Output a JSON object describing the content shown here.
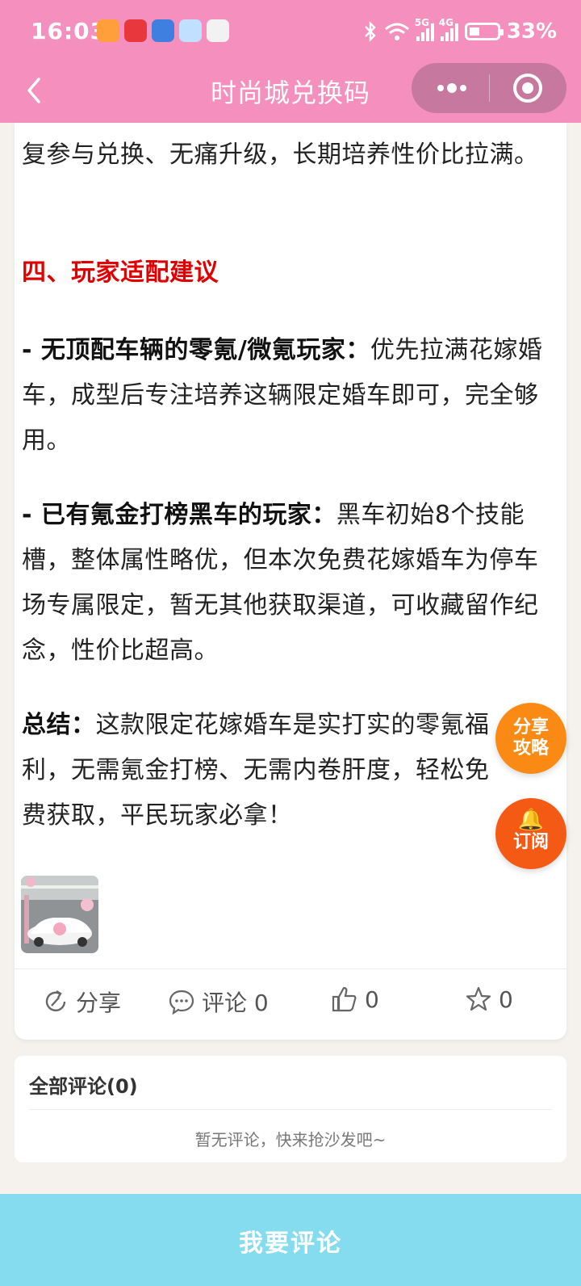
{
  "status_bar": {
    "time": "16:03",
    "network_1": "5G",
    "network_2": "4G",
    "battery": "33%"
  },
  "header": {
    "title": "时尚城兑换码"
  },
  "article": {
    "para1": "复参与兑换、无痛升级，长期培养性价比拉满。",
    "heading4": "四、玩家适配建议",
    "tip1_bold": "- 无顶配车辆的零氪/微氪玩家：",
    "tip1_text": "优先拉满花嫁婚车，成型后专注培养这辆限定婚车即可，完全够用。",
    "tip2_bold": "- 已有氪金打榜黑车的玩家：",
    "tip2_text": "黑车初始8个技能槽，整体属性略优，但本次免费花嫁婚车为停车场专属限定，暂无其他获取渠道，可收藏留作纪念，性价比超高。",
    "summary_bold": "总结：",
    "summary_text": "这款限定花嫁婚车是实打实的零氪福利，无需氪金打榜、无需内卷肝度，轻松免费获取，平民玩家必拿！"
  },
  "actions": {
    "share_label": "分享",
    "comment_label": "评论 0",
    "like_count": "0",
    "star_count": "0"
  },
  "floating": {
    "share_line1": "分享",
    "share_line2": "攻略",
    "subscribe_label": "订阅"
  },
  "comments": {
    "title": "全部评论(0)",
    "empty_text": "暂无评论，快来抢沙发吧~"
  },
  "bottom_button": {
    "label": "我要评论"
  },
  "colors": {
    "header_bg": "#f48fbe",
    "heading_red": "#e00000",
    "fab_orange": "#fb8a14",
    "bottom_bg": "#86dcef"
  }
}
